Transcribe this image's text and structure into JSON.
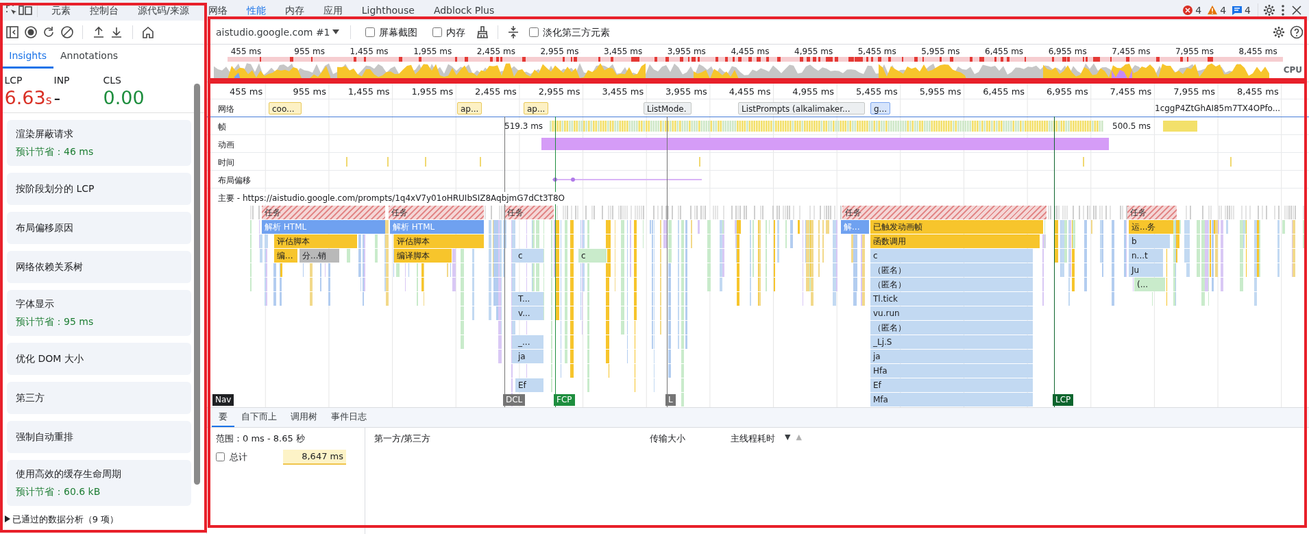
{
  "devtools_tabs": [
    {
      "label": "元素",
      "selected": false
    },
    {
      "label": "控制台",
      "selected": false
    },
    {
      "label": "源代码/来源",
      "selected": false
    },
    {
      "label": "网络",
      "selected": false
    },
    {
      "label": "性能",
      "selected": true
    },
    {
      "label": "内存",
      "selected": false
    },
    {
      "label": "应用",
      "selected": false
    },
    {
      "label": "Lighthouse",
      "selected": false
    },
    {
      "label": "Adblock Plus",
      "selected": false
    }
  ],
  "issue_counts": [
    {
      "kind": "error",
      "count": "4"
    },
    {
      "kind": "warning",
      "count": "4"
    },
    {
      "kind": "info",
      "count": "4"
    }
  ],
  "toolbar": {
    "target": "aistudio.google.com #1",
    "options": [
      {
        "label": "屏幕截图",
        "checked": false
      },
      {
        "label": "内存",
        "checked": false
      },
      {
        "label": "淡化第三方元素",
        "checked": false
      }
    ]
  },
  "sidebar": {
    "tabs": [
      {
        "label": "Insights",
        "selected": true
      },
      {
        "label": "Annotations",
        "selected": false
      }
    ],
    "metrics": [
      {
        "name": "LCP",
        "value": "6.63",
        "unit": "s",
        "color": "#d93025"
      },
      {
        "name": "INP",
        "value": "-",
        "color": "#202124"
      },
      {
        "name": "CLS",
        "value": "0.00",
        "color": "#1e8e3e"
      }
    ],
    "insights": [
      {
        "title": "渲染屏蔽请求",
        "savings": "预计节省：46 ms"
      },
      {
        "title": "按阶段划分的 LCP"
      },
      {
        "title": "布局偏移原因"
      },
      {
        "title": "网络依赖关系树"
      },
      {
        "title": "字体显示",
        "savings": "预计节省：95 ms"
      },
      {
        "title": "优化 DOM 大小"
      },
      {
        "title": "第三方"
      },
      {
        "title": "强制自动重排"
      },
      {
        "title": "使用高效的缓存生命周期",
        "savings": "预计节省：60.6 kB"
      }
    ],
    "passed": "已通过的数据分析（9 项）"
  },
  "overview": {
    "ticks": [
      "455 ms",
      "955 ms",
      "1,455 ms",
      "1,955 ms",
      "2,455 ms",
      "2,955 ms",
      "3,455 ms",
      "3,955 ms",
      "4,455 ms",
      "4,955 ms",
      "5,455 ms",
      "5,955 ms",
      "6,455 ms",
      "6,955 ms",
      "7,455 ms",
      "7,955 ms",
      "8,455 ms"
    ],
    "cpu_label": "CPU"
  },
  "timeline": {
    "ticks": [
      "455 ms",
      "955 ms",
      "1,455 ms",
      "1,955 ms",
      "2,455 ms",
      "2,955 ms",
      "3,455 ms",
      "3,955 ms",
      "4,455 ms",
      "4,955 ms",
      "5,455 ms",
      "5,955 ms",
      "6,455 ms",
      "6,955 ms",
      "7,455 ms",
      "7,955 ms",
      "8,455 ms"
    ],
    "network": {
      "label": "网络",
      "requests": [
        {
          "label": "coo...",
          "kind": "script"
        },
        {
          "label": "ap...",
          "kind": "script"
        },
        {
          "label": "ap...",
          "kind": "script"
        },
        {
          "label": "ListMode.",
          "kind": "fetch"
        },
        {
          "label": "ListPrompts (alkalimaker...",
          "kind": "fetch"
        },
        {
          "label": "g...",
          "kind": "document"
        },
        {
          "label": "1cggP4ZtGhAI85m7TX4OPfo...",
          "kind": "plain"
        }
      ]
    },
    "frames": {
      "label": "帧",
      "readings": [
        "519.3 ms",
        "500.5 ms"
      ]
    },
    "animations": {
      "label": "动画"
    },
    "timings": {
      "label": "时间"
    },
    "layout_shifts": {
      "label": "布局偏移"
    },
    "main": {
      "label": "主要 - https://aistudio.google.com/prompts/1q4xV7y01oHRUIbSIZ8AqbjmG7dCt3T8O",
      "entries": [
        {
          "label": "任务",
          "kind": "task"
        },
        {
          "label": "任务",
          "kind": "task"
        },
        {
          "label": "任务",
          "kind": "task"
        },
        {
          "label": "任务",
          "kind": "task"
        },
        {
          "label": "任务",
          "kind": "task"
        },
        {
          "label": "解析 HTML",
          "kind": "parse"
        },
        {
          "label": "解析 HTML",
          "kind": "parse"
        },
        {
          "label": "解...",
          "kind": "parse"
        },
        {
          "label": "已触发动画帧",
          "kind": "script"
        },
        {
          "label": "运...务",
          "kind": "script"
        },
        {
          "label": "评估脚本",
          "kind": "script"
        },
        {
          "label": "评估脚本",
          "kind": "script"
        },
        {
          "label": "函数调用",
          "kind": "script"
        },
        {
          "label": "b",
          "kind": "call"
        },
        {
          "label": "编...",
          "kind": "script"
        },
        {
          "label": "分...销",
          "kind": "gc"
        },
        {
          "label": "编译脚本",
          "kind": "script"
        },
        {
          "label": "c",
          "kind": "call"
        },
        {
          "label": "c",
          "kind": "green"
        },
        {
          "label": "c",
          "kind": "call"
        },
        {
          "label": "n...t",
          "kind": "call"
        },
        {
          "label": "（匿名）",
          "kind": "call"
        },
        {
          "label": "Ju",
          "kind": "call"
        },
        {
          "label": "（匿名）",
          "kind": "call"
        },
        {
          "label": "(...",
          "kind": "green"
        },
        {
          "label": "T...",
          "kind": "call"
        },
        {
          "label": "Tl.tick",
          "kind": "call"
        },
        {
          "label": "v...",
          "kind": "call"
        },
        {
          "label": "vu.run",
          "kind": "call"
        },
        {
          "label": "（匿名）",
          "kind": "call"
        },
        {
          "label": "_...",
          "kind": "call"
        },
        {
          "label": "_Lj.S",
          "kind": "call"
        },
        {
          "label": "ja",
          "kind": "call"
        },
        {
          "label": "ja",
          "kind": "call"
        },
        {
          "label": "Hfa",
          "kind": "call"
        },
        {
          "label": "Ef",
          "kind": "call"
        },
        {
          "label": "Ef",
          "kind": "call"
        },
        {
          "label": "Mfa",
          "kind": "call"
        }
      ]
    },
    "markers": [
      {
        "label": "Nav",
        "color": "#202124"
      },
      {
        "label": "DCL",
        "color": "#757575"
      },
      {
        "label": "FCP",
        "color": "#1e8e3e"
      },
      {
        "label": "L",
        "color": "#757575"
      },
      {
        "label": "LCP",
        "color": "#0d652d"
      }
    ]
  },
  "details": {
    "tabs": [
      {
        "label": "要",
        "selected": true
      },
      {
        "label": "自下而上",
        "selected": false
      },
      {
        "label": "调用树",
        "selected": false
      },
      {
        "label": "事件日志",
        "selected": false
      }
    ],
    "range": "范围：0 ms - 8.65 秒",
    "total": {
      "label": "总计",
      "value": "8,647 ms",
      "checked": false
    },
    "columns": [
      "第一方/第三方",
      "传输大小",
      "主线程耗时"
    ],
    "sort_arrows": [
      {
        "glyph": "▼",
        "active": true
      },
      {
        "glyph": "▲",
        "active": false
      }
    ]
  }
}
